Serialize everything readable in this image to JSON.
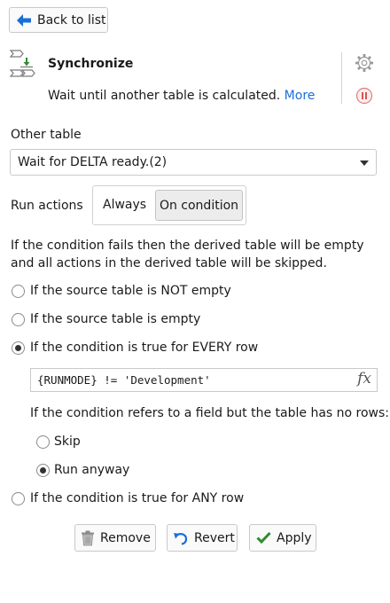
{
  "nav": {
    "back_label": "Back to list"
  },
  "step": {
    "title": "Synchronize",
    "description": "Wait until another table is calculated.",
    "more_link": "More"
  },
  "other_table": {
    "label": "Other table",
    "selected": "Wait for DELTA ready.(2)"
  },
  "run_actions": {
    "label": "Run actions",
    "options": [
      "Always",
      "On condition"
    ],
    "selected": "On condition"
  },
  "condition_note": "If the condition fails then the derived table will be empty and all actions in the derived table will be skipped.",
  "conditions": [
    {
      "label": "If the source table is NOT empty",
      "checked": false
    },
    {
      "label": "If the source table is empty",
      "checked": false
    },
    {
      "label": "If the condition is true for EVERY row",
      "checked": true
    },
    {
      "label": "If the condition is true for ANY row",
      "checked": false
    }
  ],
  "expression": {
    "value": "{RUNMODE} != 'Development'",
    "fx_label": "fx"
  },
  "no_rows": {
    "question": "If the condition refers to a field but the table has no rows:",
    "options": [
      {
        "label": "Skip",
        "checked": false
      },
      {
        "label": "Run anyway",
        "checked": true
      }
    ]
  },
  "footer": {
    "remove": "Remove",
    "revert": "Revert",
    "apply": "Apply"
  },
  "colors": {
    "link": "#1a6ed8",
    "apply_check": "#2e8b2e",
    "stop_icon": "#d9534f"
  }
}
